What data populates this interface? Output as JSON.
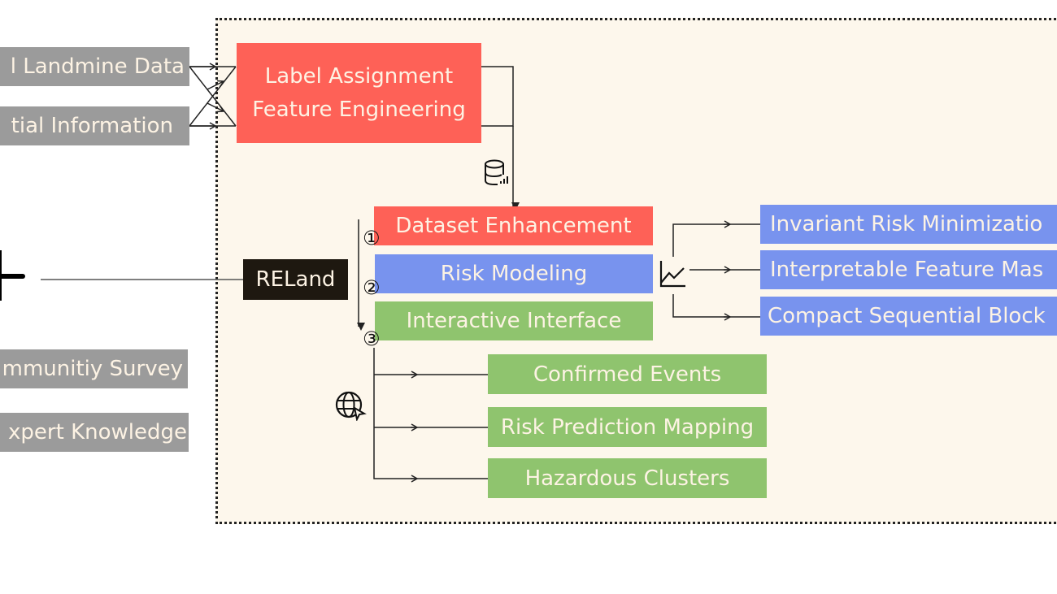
{
  "inputs": {
    "landmine_data": "l Landmine Data",
    "spatial_information": "tial Information",
    "community_survey": "mmunitiy Survey",
    "expert_knowledge": "xpert Knowledge"
  },
  "preprocess": {
    "line1": "Label Assignment",
    "line2": "Feature Engineering"
  },
  "center": {
    "label": "RELand"
  },
  "stages": [
    {
      "number": "①",
      "label": "Dataset Enhancement"
    },
    {
      "number": "②",
      "label": "Risk Modeling"
    },
    {
      "number": "③",
      "label": "Interactive Interface"
    }
  ],
  "modeling_components": [
    "Invariant Risk Minimizatio",
    "Interpretable Feature Mas",
    "Compact Sequential Block"
  ],
  "interface_components": [
    "Confirmed Events",
    "Risk Prediction Mapping",
    "Hazardous Clusters"
  ],
  "colors": {
    "input_gray": "#9b9b9b",
    "data_red": "#fe6157",
    "model_blue": "#7893ee",
    "interface_green": "#8fc46e",
    "core_dark": "#1e1810",
    "panel_bg": "#fdf7ec"
  }
}
